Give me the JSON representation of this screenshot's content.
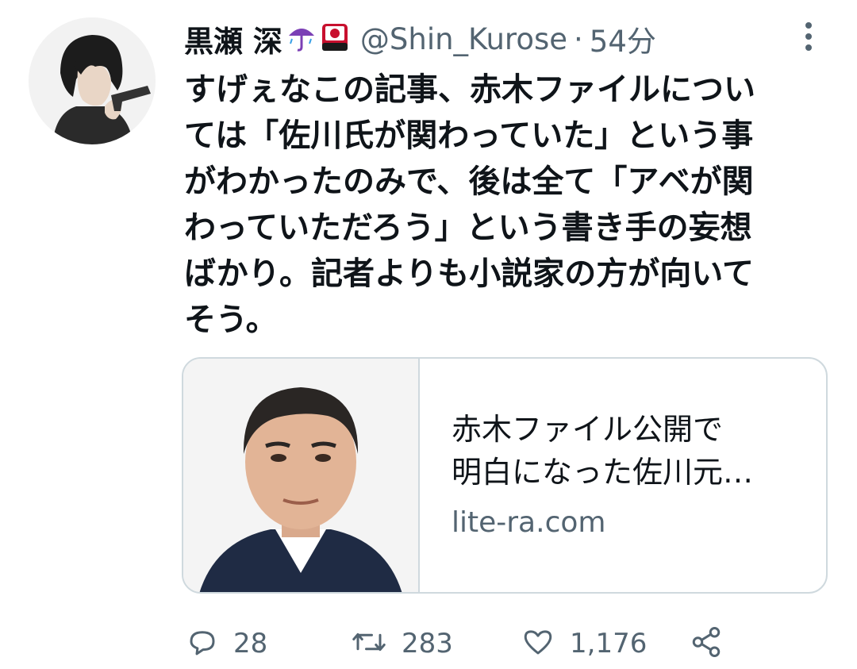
{
  "tweet": {
    "display_name": "黒瀬 深",
    "name_emojis": [
      "umbrella-rain-emoji",
      "red-flag-card-emoji"
    ],
    "handle": "@Shin_Kurose",
    "separator": "·",
    "time": "54分",
    "text_lines": [
      "すげぇなこの記事、赤木ファイルについ",
      "ては「佐川氏が関わっていた」という事",
      "がわかったのみで、後は全て「アベが関",
      "わっていただろう」という書き手の妄想",
      "ばかり。記者よりも小説家の方が向いて",
      "そう。"
    ]
  },
  "card": {
    "title_lines": [
      "赤木ファイル公開で",
      "明白になった佐川元…"
    ],
    "domain": "lite-ra.com"
  },
  "actions": {
    "replies": "28",
    "retweets": "283",
    "likes": "1,176"
  },
  "colors": {
    "text": "#0f1419",
    "secondary": "#536471",
    "border": "#cfd9de"
  }
}
